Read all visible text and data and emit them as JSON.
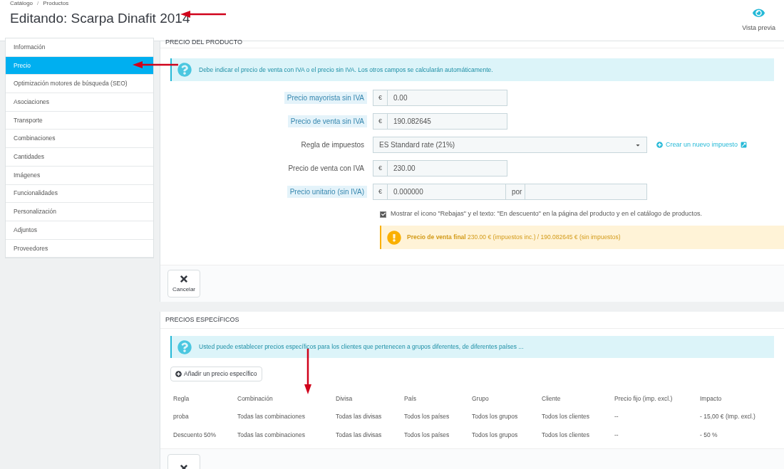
{
  "breadcrumb": [
    "Catálogo",
    "Productos"
  ],
  "breadcrumb_separator": "/",
  "title": "Editando: Scarpa Dinafit 2014",
  "toolbar": [
    {
      "label": "Vista previa"
    }
  ],
  "sidebar": {
    "items": [
      {
        "label": "Información",
        "selected": false
      },
      {
        "label": "Precio",
        "selected": true
      },
      {
        "label": "Optimización motores de búsqueda (SEO)",
        "selected": false
      },
      {
        "label": "Asociaciones",
        "selected": false
      },
      {
        "label": "Transporte",
        "selected": false
      },
      {
        "label": "Combinaciones",
        "selected": false
      },
      {
        "label": "Cantidades",
        "selected": false
      },
      {
        "label": "Imágenes",
        "selected": false
      },
      {
        "label": "Funcionalidades",
        "selected": false
      },
      {
        "label": "Personalización",
        "selected": false
      },
      {
        "label": "Adjuntos",
        "selected": false
      },
      {
        "label": "Proveedores",
        "selected": false
      }
    ]
  },
  "price_panel": {
    "heading": "PRECIO DEL PRODUCTO",
    "info": "Debe indicar el precio de venta con IVA o el precio sin IVA. Los otros campos se calcularán automáticamente.",
    "fields": [
      {
        "kind": "money",
        "label": "Precio mayorista sin IVA",
        "hint": true,
        "prefix": "€",
        "value": "0.00"
      },
      {
        "kind": "money",
        "label": "Precio de venta sin IVA",
        "hint": true,
        "prefix": "€",
        "value": "190.082645"
      },
      {
        "kind": "select",
        "label": "Regla de impuestos",
        "hint": false,
        "value": "ES Standard rate (21%)",
        "link": "Crear un nuevo impuesto"
      },
      {
        "kind": "money",
        "label": "Precio de venta con IVA",
        "hint": false,
        "prefix": "€",
        "value": "230.00"
      },
      {
        "kind": "unit",
        "label": "Precio unitario (sin IVA)",
        "hint": true,
        "prefix": "€",
        "value": "0.000000",
        "unit_label": "por"
      }
    ],
    "on_sale": {
      "checked": true,
      "label": "Mostrar el icono \"Rebajas\" y el texto: \"En descuento\" en la página del producto y en el catálogo de productos."
    },
    "final_price": "**Precio de venta final** 230.00 € (impuestos inc.) / 190.082645 € (sin impuestos)",
    "cancel": "Cancelar"
  },
  "specific_panel": {
    "heading": "PRECIOS ESPECÍFICOS",
    "info": "Usted puede establecer precios específicos para los clientes que pertenecen a grupos diferentes, de diferentes países ...",
    "add_button": "Añadir un precio específico",
    "table": {
      "columns": [
        "Regla",
        "Combinación",
        "Divisa",
        "País",
        "Grupo",
        "Cliente",
        "Precio fijo (imp. excl.)",
        "Impacto"
      ],
      "rows": [
        [
          "proba",
          "Todas las combinaciones",
          "Todas las divisas",
          "Todos los países",
          "Todos los grupos",
          "Todos los clientes",
          "--",
          "- 15,00 € (Imp. excl.)"
        ],
        [
          "Descuento 50%",
          "Todas las combinaciones",
          "Todas las divisas",
          "Todos los países",
          "Todos los grupos",
          "Todos los clientes",
          "--",
          "- 50 %"
        ]
      ]
    }
  }
}
